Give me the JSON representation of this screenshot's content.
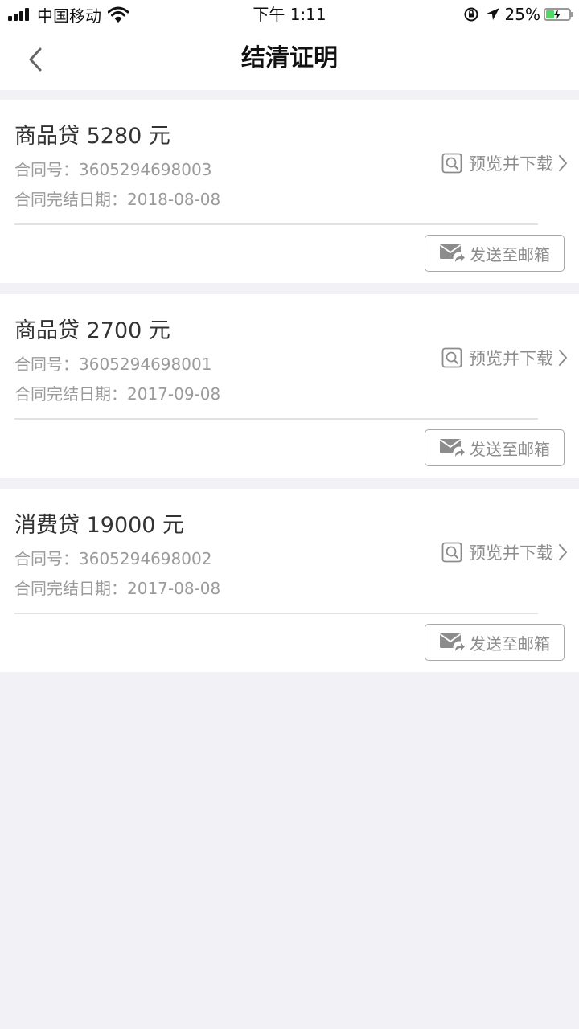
{
  "status_bar": {
    "carrier": "中国移动",
    "time": "下午 1:11",
    "battery": "25%",
    "battery_level": 0.25,
    "icons": [
      "signal-icon",
      "wifi-icon",
      "orientation-lock-icon",
      "location-arrow-icon",
      "battery-charging-icon"
    ]
  },
  "nav": {
    "title": "结清证明",
    "back_icon": "chevron-left-icon"
  },
  "labels": {
    "contract_prefix": "合同号：",
    "date_prefix": "合同完结日期：",
    "preview": "预览并下载",
    "send_email": "发送至邮箱"
  },
  "loans": [
    {
      "title": "商品贷 5280 元",
      "contract_no": "3605294698003",
      "end_date": "2018-08-08"
    },
    {
      "title": "商品贷 2700 元",
      "contract_no": "3605294698001",
      "end_date": "2017-09-08"
    },
    {
      "title": "消费贷 19000 元",
      "contract_no": "3605294698002",
      "end_date": "2017-08-08"
    }
  ],
  "colors": {
    "page_bg": "#f1f1f6",
    "card_bg": "#ffffff",
    "primary_text": "#333333",
    "secondary_text": "#9b9b9b",
    "battery_green": "#4cd964"
  }
}
